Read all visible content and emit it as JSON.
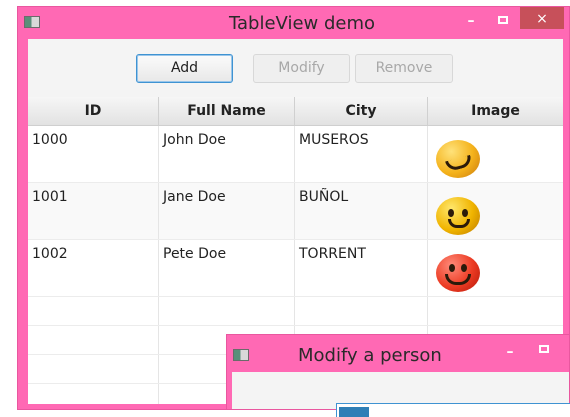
{
  "main_window": {
    "title": "TableView demo",
    "controls": {
      "minimize": "–",
      "close": "×"
    }
  },
  "toolbar": {
    "add_label": "Add",
    "modify_label": "Modify",
    "remove_label": "Remove"
  },
  "table": {
    "columns": [
      "ID",
      "Full Name",
      "City",
      "Image"
    ],
    "rows": [
      {
        "id": "1000",
        "name": "John Doe",
        "city": "MUSEROS",
        "image": "crying-laughing-face-icon"
      },
      {
        "id": "1001",
        "name": "Jane Doe",
        "city": "BUÑOL",
        "image": "dizzy-face-icon"
      },
      {
        "id": "1002",
        "name": "Pete Doe",
        "city": "TORRENT",
        "image": "smiling-face-icon"
      }
    ]
  },
  "modal_window": {
    "title": "Modify a person",
    "controls": {
      "minimize": "–"
    }
  },
  "colors": {
    "window_frame": "#ff69b4",
    "accent_blue": "#3f93d2",
    "close_red": "#c7505a"
  }
}
